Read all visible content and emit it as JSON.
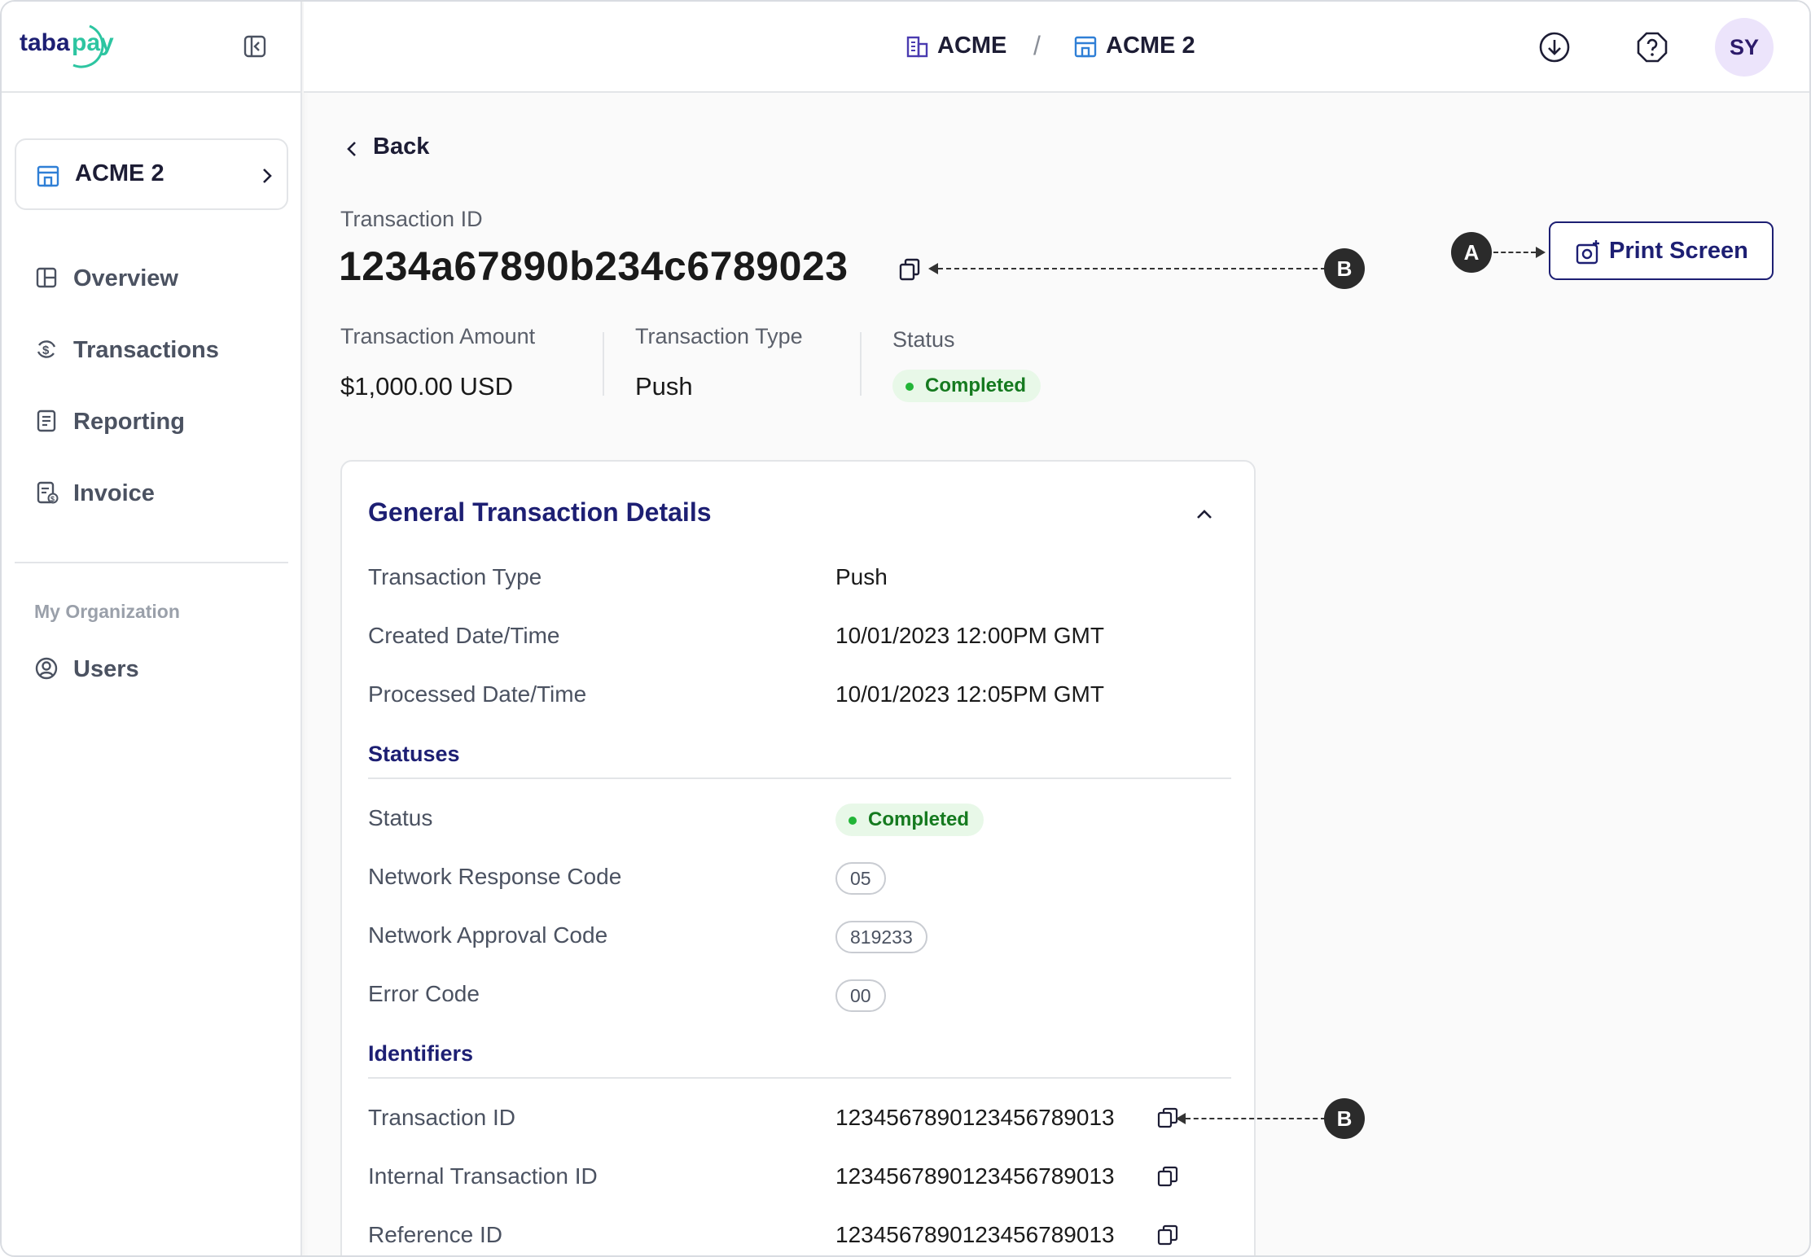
{
  "brand": {
    "name": "tabapay",
    "colors": {
      "navy": "#1d1f73",
      "teal": "#2dc5a1",
      "status_green": "#157a1f"
    }
  },
  "sidebar": {
    "org_card": {
      "label": "ACME 2",
      "icon": "building-icon"
    },
    "items": [
      {
        "label": "Overview",
        "icon": "overview-icon"
      },
      {
        "label": "Transactions",
        "icon": "transactions-icon"
      },
      {
        "label": "Reporting",
        "icon": "reporting-icon"
      },
      {
        "label": "Invoice",
        "icon": "invoice-icon"
      }
    ],
    "section_label": "My Organization",
    "org_items": [
      {
        "label": "Users",
        "icon": "user-icon"
      }
    ]
  },
  "header": {
    "breadcrumb": [
      {
        "label": "ACME",
        "icon": "building-icon"
      },
      {
        "label": "ACME 2",
        "icon": "store-icon"
      }
    ],
    "separator": "/",
    "avatar_initials": "SY"
  },
  "main": {
    "back_label": "Back",
    "transaction_id_label": "Transaction ID",
    "transaction_id": "1234a67890b234c6789023",
    "print_label": "Print Screen",
    "annotations": {
      "a": "A",
      "b": "B"
    },
    "summary": {
      "amount_label": "Transaction Amount",
      "amount": "$1,000.00 USD",
      "type_label": "Transaction Type",
      "type": "Push",
      "status_label": "Status",
      "status": "Completed"
    },
    "details": {
      "title": "General Transaction Details",
      "rows": [
        {
          "label": "Transaction Type",
          "value": "Push"
        },
        {
          "label": "Created Date/Time",
          "value": "10/01/2023 12:00PM GMT"
        },
        {
          "label": "Processed Date/Time",
          "value": "10/01/2023 12:05PM GMT"
        }
      ],
      "statuses_title": "Statuses",
      "status_rows": [
        {
          "label": "Status",
          "value": "Completed"
        },
        {
          "label": "Network Response Code",
          "value": "05"
        },
        {
          "label": "Network Approval Code",
          "value": "819233"
        },
        {
          "label": "Error Code",
          "value": "00"
        }
      ],
      "identifiers_title": "Identifiers",
      "identifier_rows": [
        {
          "label": "Transaction ID",
          "value": "1234567890123456789013"
        },
        {
          "label": "Internal Transaction ID",
          "value": "1234567890123456789013"
        },
        {
          "label": "Reference ID",
          "value": "1234567890123456789013"
        }
      ]
    }
  }
}
